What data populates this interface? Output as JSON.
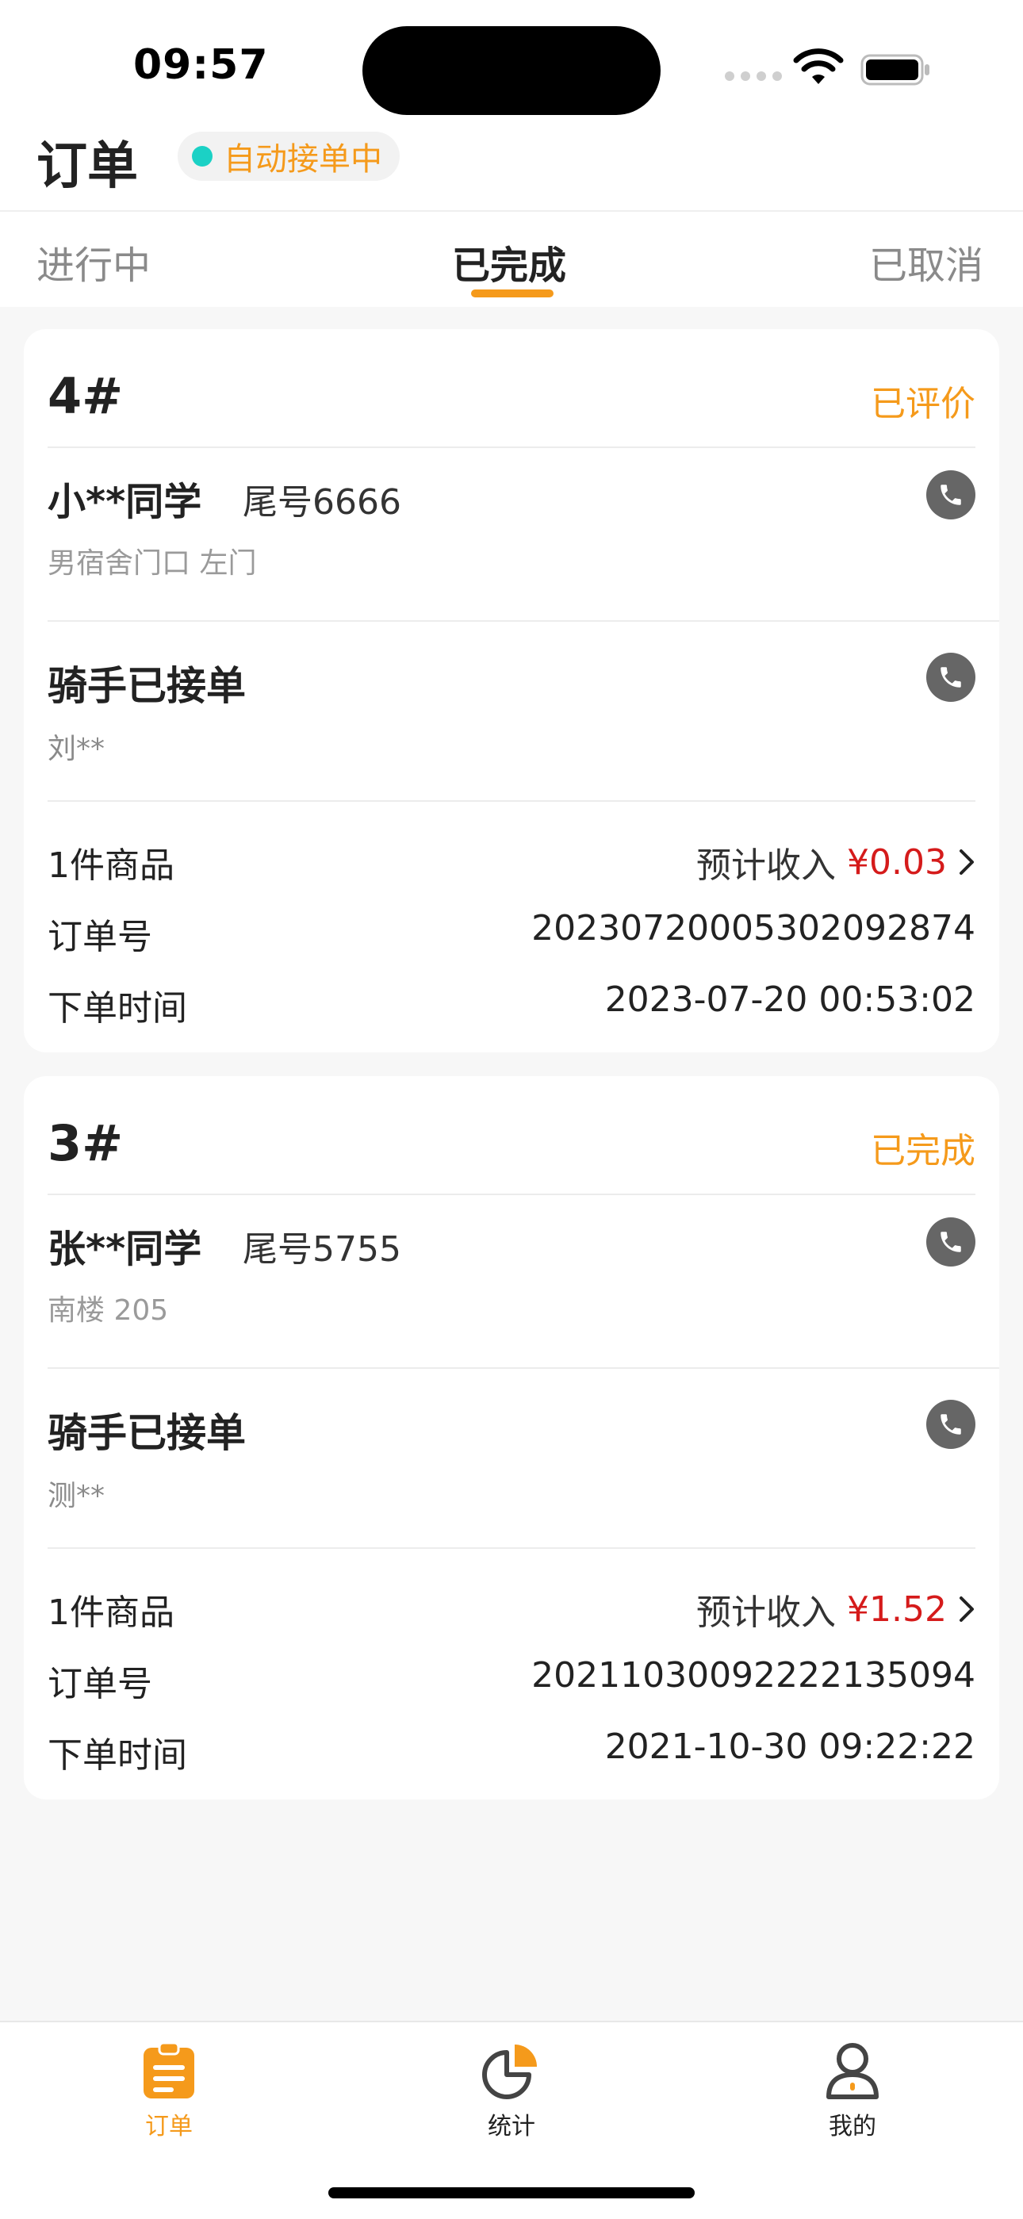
{
  "status_bar": {
    "time": "09:57"
  },
  "header": {
    "title": "订单",
    "auto_accept": "自动接单中"
  },
  "tabs": [
    {
      "label": "进行中",
      "active": false
    },
    {
      "label": "已完成",
      "active": true
    },
    {
      "label": "已取消",
      "active": false
    }
  ],
  "orders": [
    {
      "number": "4#",
      "state": "已评价",
      "customer": {
        "name": "小**同学",
        "tail": "尾号6666",
        "address": "男宿舍门口 左门"
      },
      "rider": {
        "title": "骑手已接单",
        "name": "刘**"
      },
      "items_label": "1件商品",
      "income_label": "预计收入",
      "income_amount": "¥0.03",
      "order_no_label": "订单号",
      "order_no": "20230720005302092874",
      "time_label": "下单时间",
      "time": "2023-07-20 00:53:02"
    },
    {
      "number": "3#",
      "state": "已完成",
      "customer": {
        "name": "张**同学",
        "tail": "尾号5755",
        "address": "南楼 205"
      },
      "rider": {
        "title": "骑手已接单",
        "name": "测**"
      },
      "items_label": "1件商品",
      "income_label": "预计收入",
      "income_amount": "¥1.52",
      "order_no_label": "订单号",
      "order_no": "20211030092222135094",
      "time_label": "下单时间",
      "time": "2021-10-30 09:22:22"
    }
  ],
  "bottom_nav": [
    {
      "label": "订单",
      "icon": "clipboard-icon",
      "active": true
    },
    {
      "label": "统计",
      "icon": "pie-chart-icon",
      "active": false
    },
    {
      "label": "我的",
      "icon": "person-icon",
      "active": false
    }
  ],
  "colors": {
    "accent": "#f59a1b",
    "price": "#d51b1b",
    "online_dot": "#1bd1c5"
  }
}
